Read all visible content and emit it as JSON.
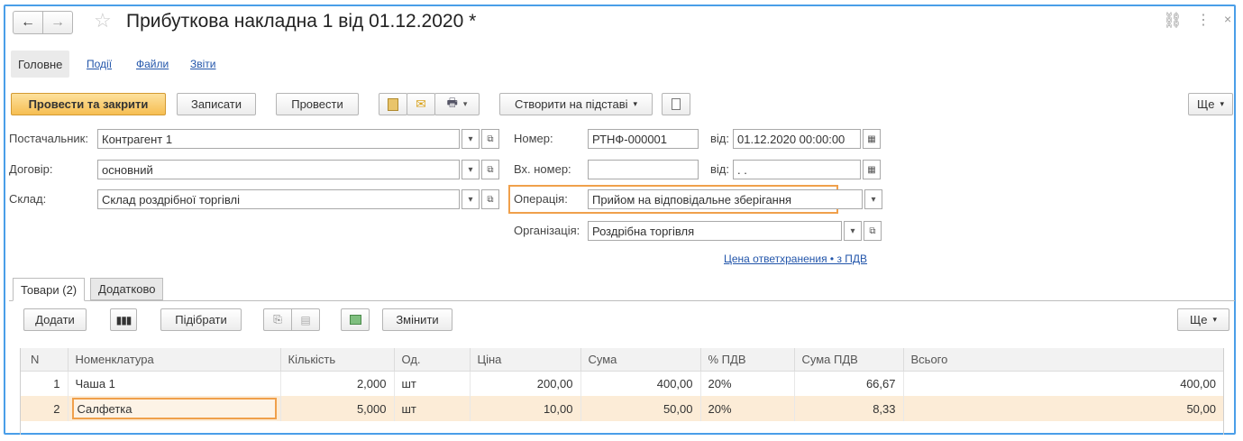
{
  "window": {
    "title": "Прибуткова накладна 1 від 01.12.2020 *"
  },
  "nav_tabs": [
    {
      "label": "Головне"
    },
    {
      "label": "Події"
    },
    {
      "label": "Файли"
    },
    {
      "label": "Звіти"
    }
  ],
  "toolbar": {
    "post_close": "Провести та закрити",
    "save": "Записати",
    "post": "Провести",
    "create_based": "Створити на підставі",
    "more": "Ще"
  },
  "form": {
    "supplier_label": "Постачальник:",
    "supplier_value": "Контрагент 1",
    "contract_label": "Договір:",
    "contract_value": "основний",
    "warehouse_label": "Склад:",
    "warehouse_value": "Склад роздрібної торгівлі",
    "number_label": "Номер:",
    "number_value": "РТНФ-000001",
    "date_label": "від:",
    "date_value": "01.12.2020 00:00:00",
    "in_number_label": "Вх. номер:",
    "in_number_value": "",
    "in_date_label": "від:",
    "in_date_value": " .  .",
    "operation_label": "Операція:",
    "operation_value": "Прийом на відповідальне зберігання",
    "org_label": "Організація:",
    "org_value": "Роздрібна торгівля",
    "price_link": "Цена ответхранения • з ПДВ"
  },
  "content_tabs": [
    {
      "label": "Товари (2)"
    },
    {
      "label": "Додатково"
    }
  ],
  "goods_toolbar": {
    "add": "Додати",
    "pick": "Підібрати",
    "change": "Змінити",
    "more": "Ще"
  },
  "table": {
    "columns": [
      "N",
      "Номенклатура",
      "Кількість",
      "Од.",
      "Ціна",
      "Сума",
      "% ПДВ",
      "Сума ПДВ",
      "Всього"
    ],
    "rows": [
      {
        "n": "1",
        "name": "Чаша 1",
        "qty": "2,000",
        "unit": "шт",
        "price": "200,00",
        "sum": "400,00",
        "vat_rate": "20%",
        "vat_sum": "66,67",
        "total": "400,00"
      },
      {
        "n": "2",
        "name": "Салфетка",
        "qty": "5,000",
        "unit": "шт",
        "price": "10,00",
        "sum": "50,00",
        "vat_rate": "20%",
        "vat_sum": "8,33",
        "total": "50,00"
      }
    ]
  },
  "colors": {
    "accent_frame": "#4a9ee8",
    "primary_button": "#f6be52",
    "highlight_box": "#f0a04b",
    "selected_row": "#fcecd7",
    "link": "#2255aa"
  }
}
